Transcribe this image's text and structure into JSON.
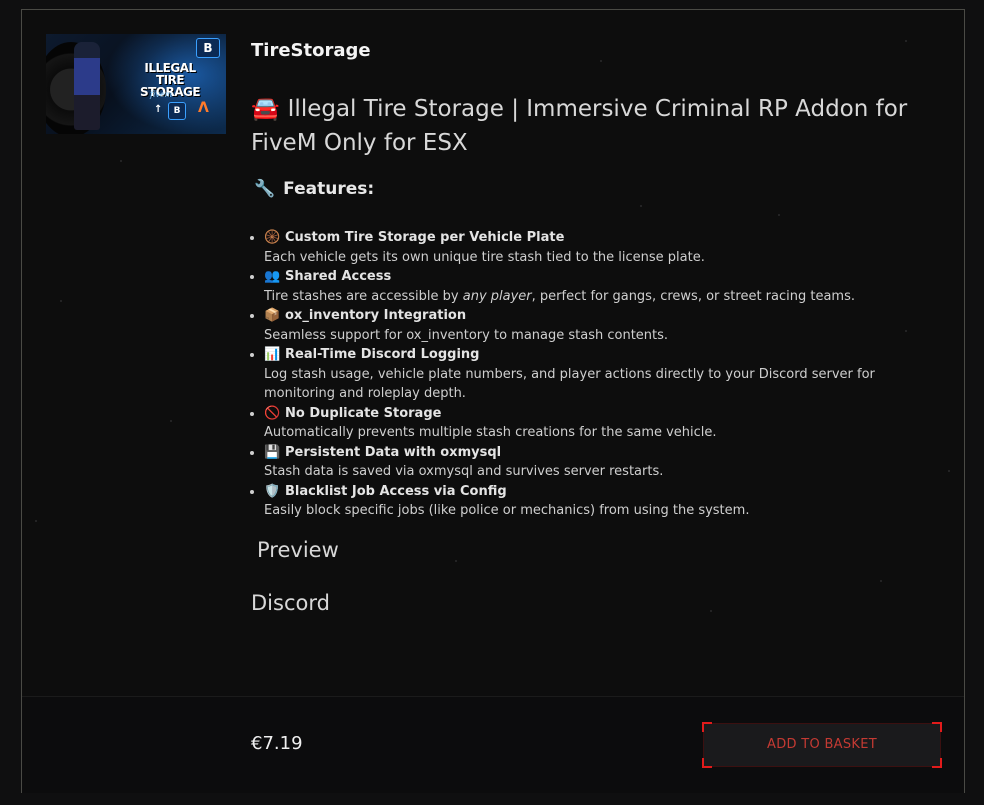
{
  "product": {
    "name": "TireStorage",
    "thumbnail": {
      "title_line1": "ILLEGAL TIRE",
      "title_line2": "STORAGE",
      "subtitle": "fivem",
      "logo_letter": "B"
    },
    "headline_emoji": "🚘",
    "headline": "Illegal Tire Storage | Immersive Criminal RP Addon for FiveM Only for ESX",
    "features_emoji": "🔧",
    "features_title": "Features:",
    "features": [
      {
        "icon": "🛞",
        "title": "Custom Tire Storage per Vehicle Plate",
        "desc": "Each vehicle gets its own unique tire stash tied to the license plate."
      },
      {
        "icon": "👥",
        "title": "Shared Access",
        "desc_before": "Tire stashes are accessible by ",
        "desc_em": "any player",
        "desc_after": ", perfect for gangs, crews, or street racing teams."
      },
      {
        "icon": "📦",
        "title": "ox_inventory Integration",
        "desc": "Seamless support for ox_inventory to manage stash contents."
      },
      {
        "icon": "📊",
        "title": "Real-Time Discord Logging",
        "desc": "Log stash usage, vehicle plate numbers, and player actions directly to your Discord server for monitoring and roleplay depth."
      },
      {
        "icon": "🚫",
        "title": "No Duplicate Storage",
        "desc": "Automatically prevents multiple stash creations for the same vehicle."
      },
      {
        "icon": "💾",
        "title": "Persistent Data with oxmysql",
        "desc": "Stash data is saved via oxmysql and survives server restarts."
      },
      {
        "icon": "🛡️",
        "title": "Blacklist Job Access via Config",
        "desc": "Easily block specific jobs (like police or mechanics) from using the system."
      }
    ],
    "preview_label": "Preview",
    "discord_label": "Discord",
    "price": "€7.19",
    "add_to_basket": "ADD TO BASKET"
  },
  "colors": {
    "background": "#0f0f10",
    "accent_red": "#e21b1b",
    "button_text": "#c43a33"
  }
}
